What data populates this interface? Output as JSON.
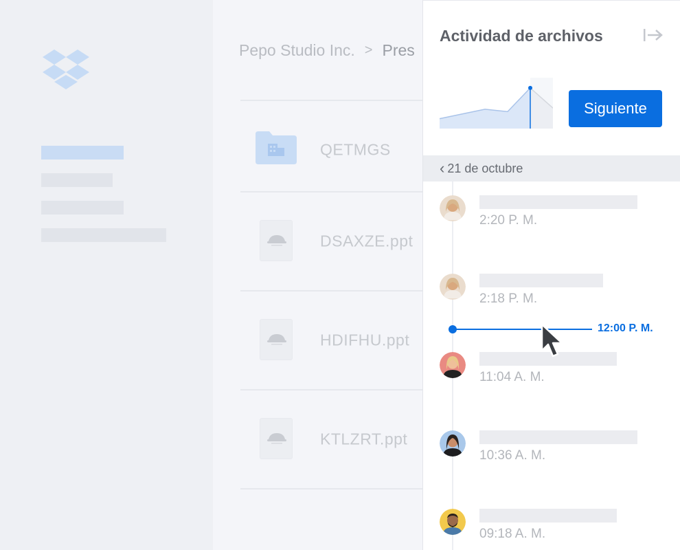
{
  "app": {
    "brand_icon": "dropbox-logo-icon",
    "accent_color": "#0a6ee0"
  },
  "breadcrumb": {
    "parent": "Pepo Studio Inc.",
    "separator": ">",
    "current": "Pres"
  },
  "files": [
    {
      "name": "QETMGS",
      "icon": "team-folder-icon"
    },
    {
      "name": "DSAXZE.ppt",
      "icon": "file-icon"
    },
    {
      "name": "HDIFHU.ppt",
      "icon": "file-icon"
    },
    {
      "name": "KTLZRT.ppt",
      "icon": "file-icon"
    }
  ],
  "panel": {
    "title": "Actividad de archivos",
    "collapse_icon": "collapse-panel-icon",
    "next_label": "Siguiente",
    "date_label": "21 de octubre",
    "marker_time": "12:00 P. M.",
    "activities": [
      {
        "time": "2:20 P. M.",
        "avatar": "avatar-1"
      },
      {
        "time": "2:18 P. M.",
        "avatar": "avatar-1"
      },
      {
        "time": "11:04 A. M.",
        "avatar": "avatar-2"
      },
      {
        "time": "10:36 A. M.",
        "avatar": "avatar-3"
      },
      {
        "time": "09:18 A. M.",
        "avatar": "avatar-4"
      }
    ]
  },
  "chart_data": {
    "type": "area",
    "x": [
      0,
      1,
      2,
      3,
      4,
      5
    ],
    "values": [
      3,
      5,
      7,
      6,
      16,
      7.5
    ],
    "highlight_index": 4,
    "ylim": [
      0,
      18
    ],
    "grid": false
  }
}
